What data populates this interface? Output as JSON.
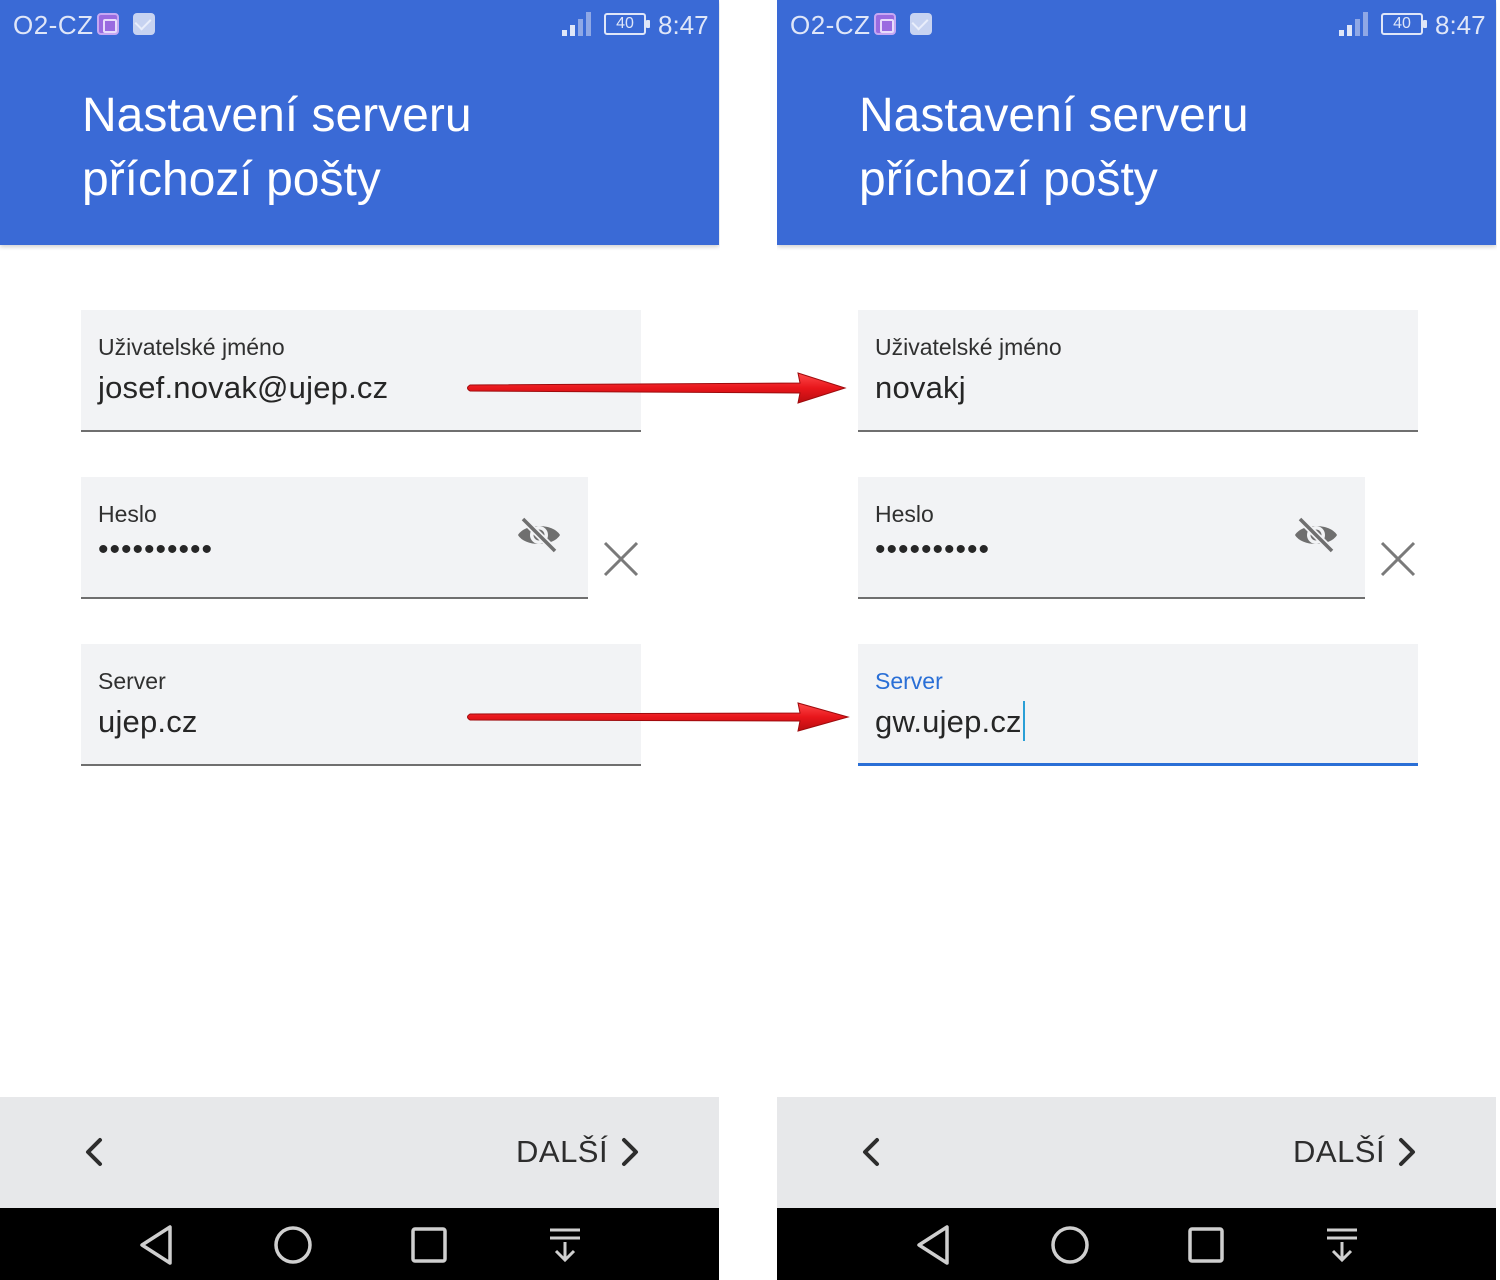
{
  "status_bar": {
    "carrier": "O2-CZ",
    "battery": "40",
    "time": "8:47"
  },
  "header": {
    "title_line1": "Nastavení serveru",
    "title_line2": "příchozí pošty"
  },
  "left": {
    "username": {
      "label": "Uživatelské jméno",
      "value": "josef.novak@ujep.cz"
    },
    "password": {
      "label": "Heslo",
      "value": "••••••••••"
    },
    "server": {
      "label": "Server",
      "value": "ujep.cz"
    }
  },
  "right": {
    "username": {
      "label": "Uživatelské jméno",
      "value": "novakj"
    },
    "password": {
      "label": "Heslo",
      "value": "••••••••••"
    },
    "server": {
      "label": "Server",
      "value": "gw.ujep.cz"
    }
  },
  "bottom": {
    "next_label": "DALŠÍ"
  },
  "icons": {
    "status": [
      "gallery-icon",
      "mail-icon",
      "signal-icon",
      "battery-icon"
    ],
    "field": [
      "eye-off-icon",
      "close-icon"
    ],
    "nav": [
      "nav-back-icon",
      "nav-home-icon",
      "nav-recent-icon",
      "nav-notification-icon"
    ]
  },
  "colors": {
    "header": "#3a6ad6",
    "accent": "#2a6fd6",
    "arrow": "#e8161b",
    "bottom_bar": "#e7e8ea",
    "nav_bar": "#000000"
  }
}
